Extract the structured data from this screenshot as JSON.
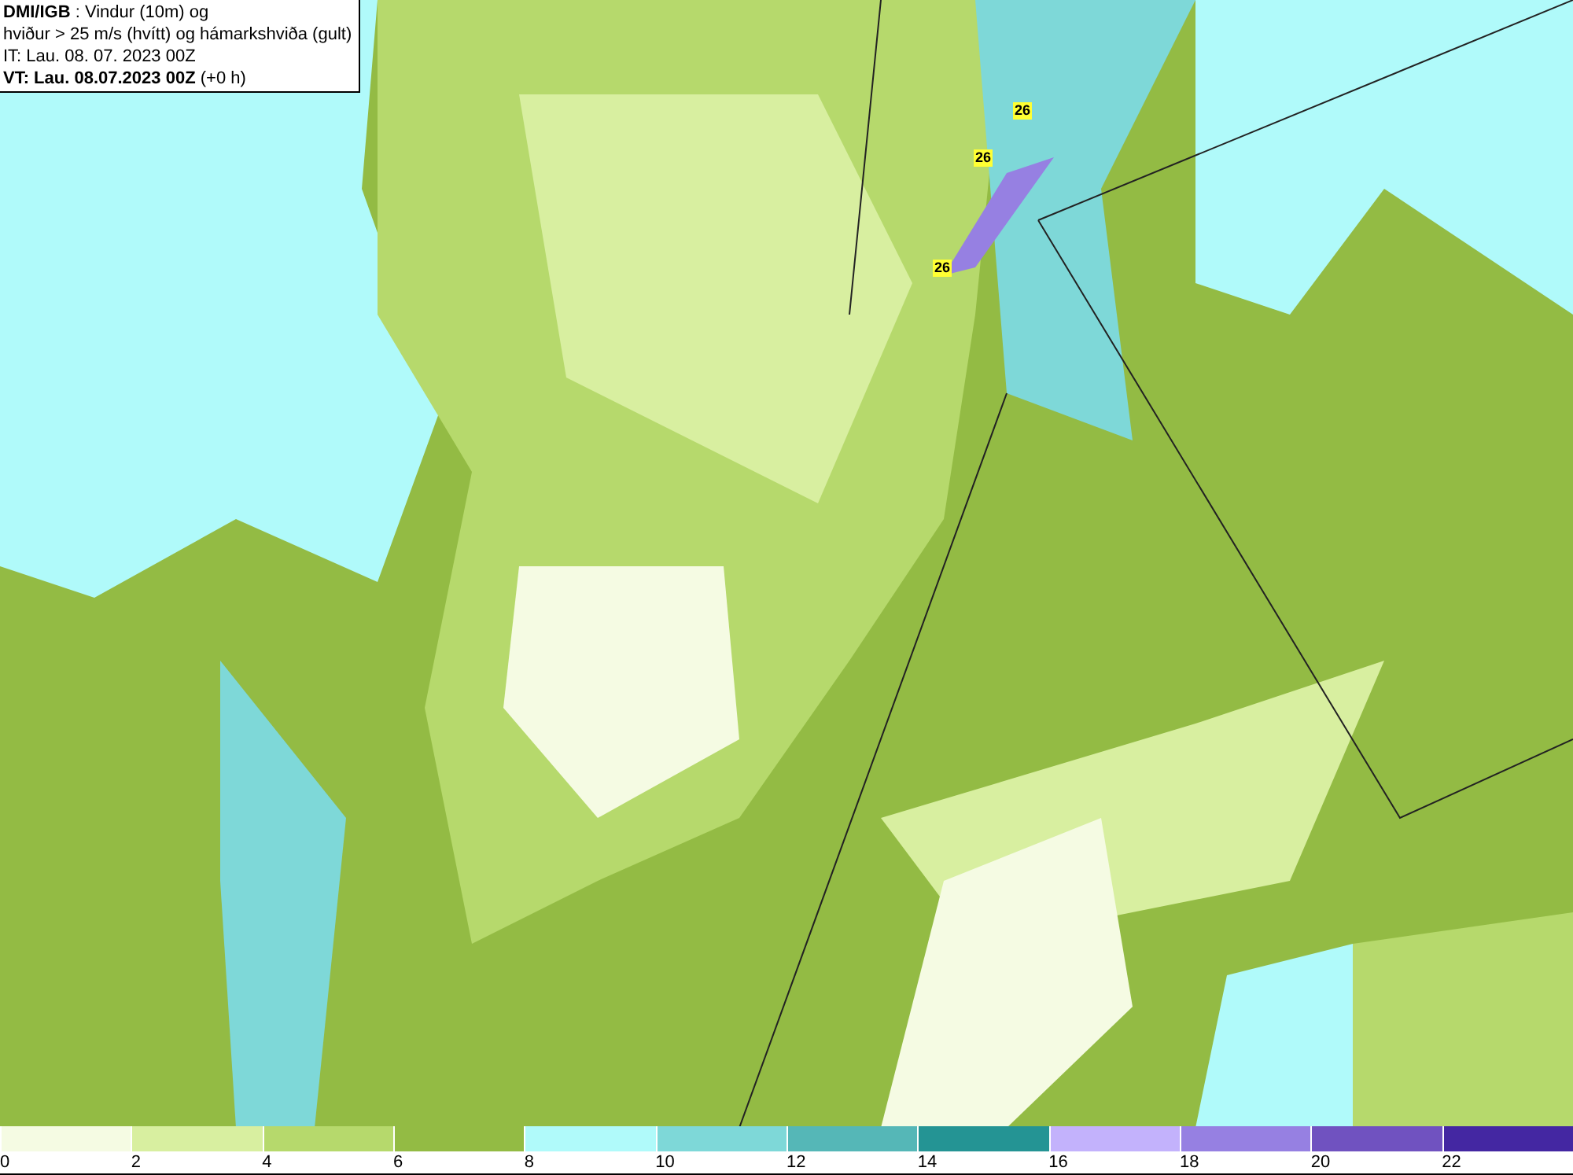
{
  "header": {
    "lines": [
      "**DMI/IGB** : Vindur (10m) og",
      "hviður > 25 m/s (hvítt) og hámarkshviða (gult)",
      "IT: Lau. 08. 07. 2023 00Z",
      "**VT: Lau. 08.07.2023 00Z** (+0 h)"
    ]
  },
  "map": {
    "gust_labels": [
      "26",
      "26",
      "26"
    ]
  },
  "legend": {
    "bins": [
      {
        "color": "#f5fbe3"
      },
      {
        "color": "#d8efa0"
      },
      {
        "color": "#b6d96c"
      },
      {
        "color": "#93bb44"
      },
      {
        "color": "#b0fafa"
      },
      {
        "color": "#7ed8d8"
      },
      {
        "color": "#55b7b7"
      },
      {
        "color": "#249494"
      },
      {
        "color": "#c3b2fc"
      },
      {
        "color": "#9680e2"
      },
      {
        "color": "#7052c0"
      },
      {
        "color": "#4427a2"
      }
    ],
    "ticks": [
      "0",
      "2",
      "4",
      "6",
      "8",
      "10",
      "12",
      "14",
      "16",
      "18",
      "20",
      "22"
    ]
  }
}
